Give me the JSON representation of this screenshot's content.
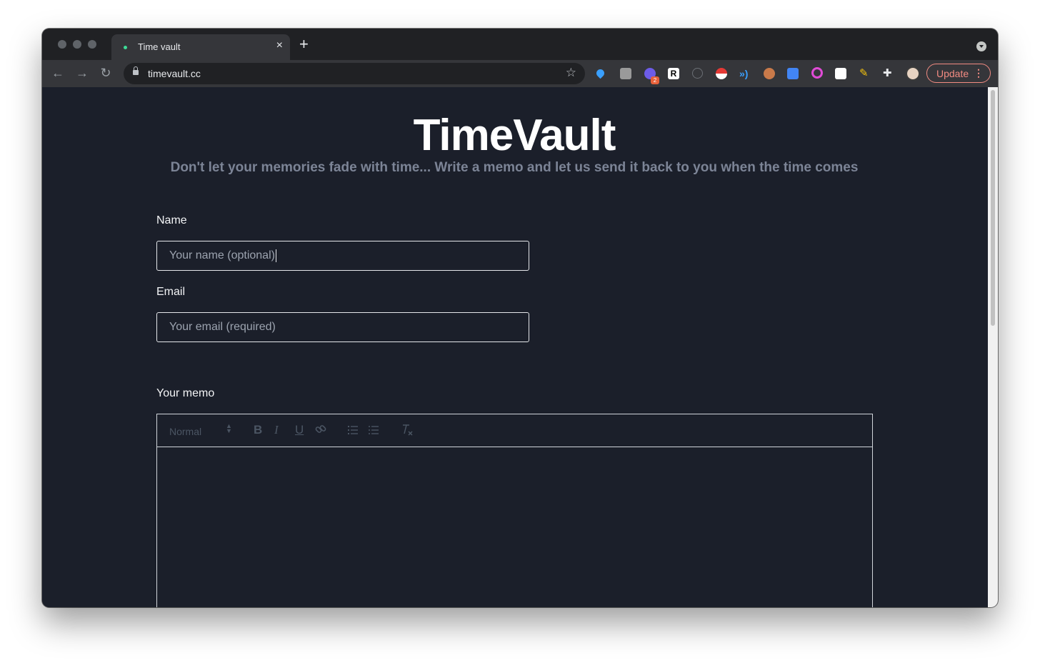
{
  "browser": {
    "tab_title": "Time vault",
    "url": "timevault.cc",
    "update_label": "Update",
    "extension_badge": "2"
  },
  "hero": {
    "title": "TimeVault",
    "subtitle": "Don't let your memories fade with time... Write a memo and let us send it back to you when the time comes"
  },
  "form": {
    "name_label": "Name",
    "name_placeholder": "Your name (optional)",
    "email_label": "Email",
    "email_placeholder": "Your email (required)",
    "memo_label": "Your memo",
    "editor": {
      "format_value": "Normal",
      "bold_label": "B",
      "italic_label": "I",
      "underline_label": "U"
    }
  },
  "colors": {
    "page_background": "#1b1f2a",
    "accent_update": "#f28b82",
    "subtitle": "#7c8496"
  }
}
